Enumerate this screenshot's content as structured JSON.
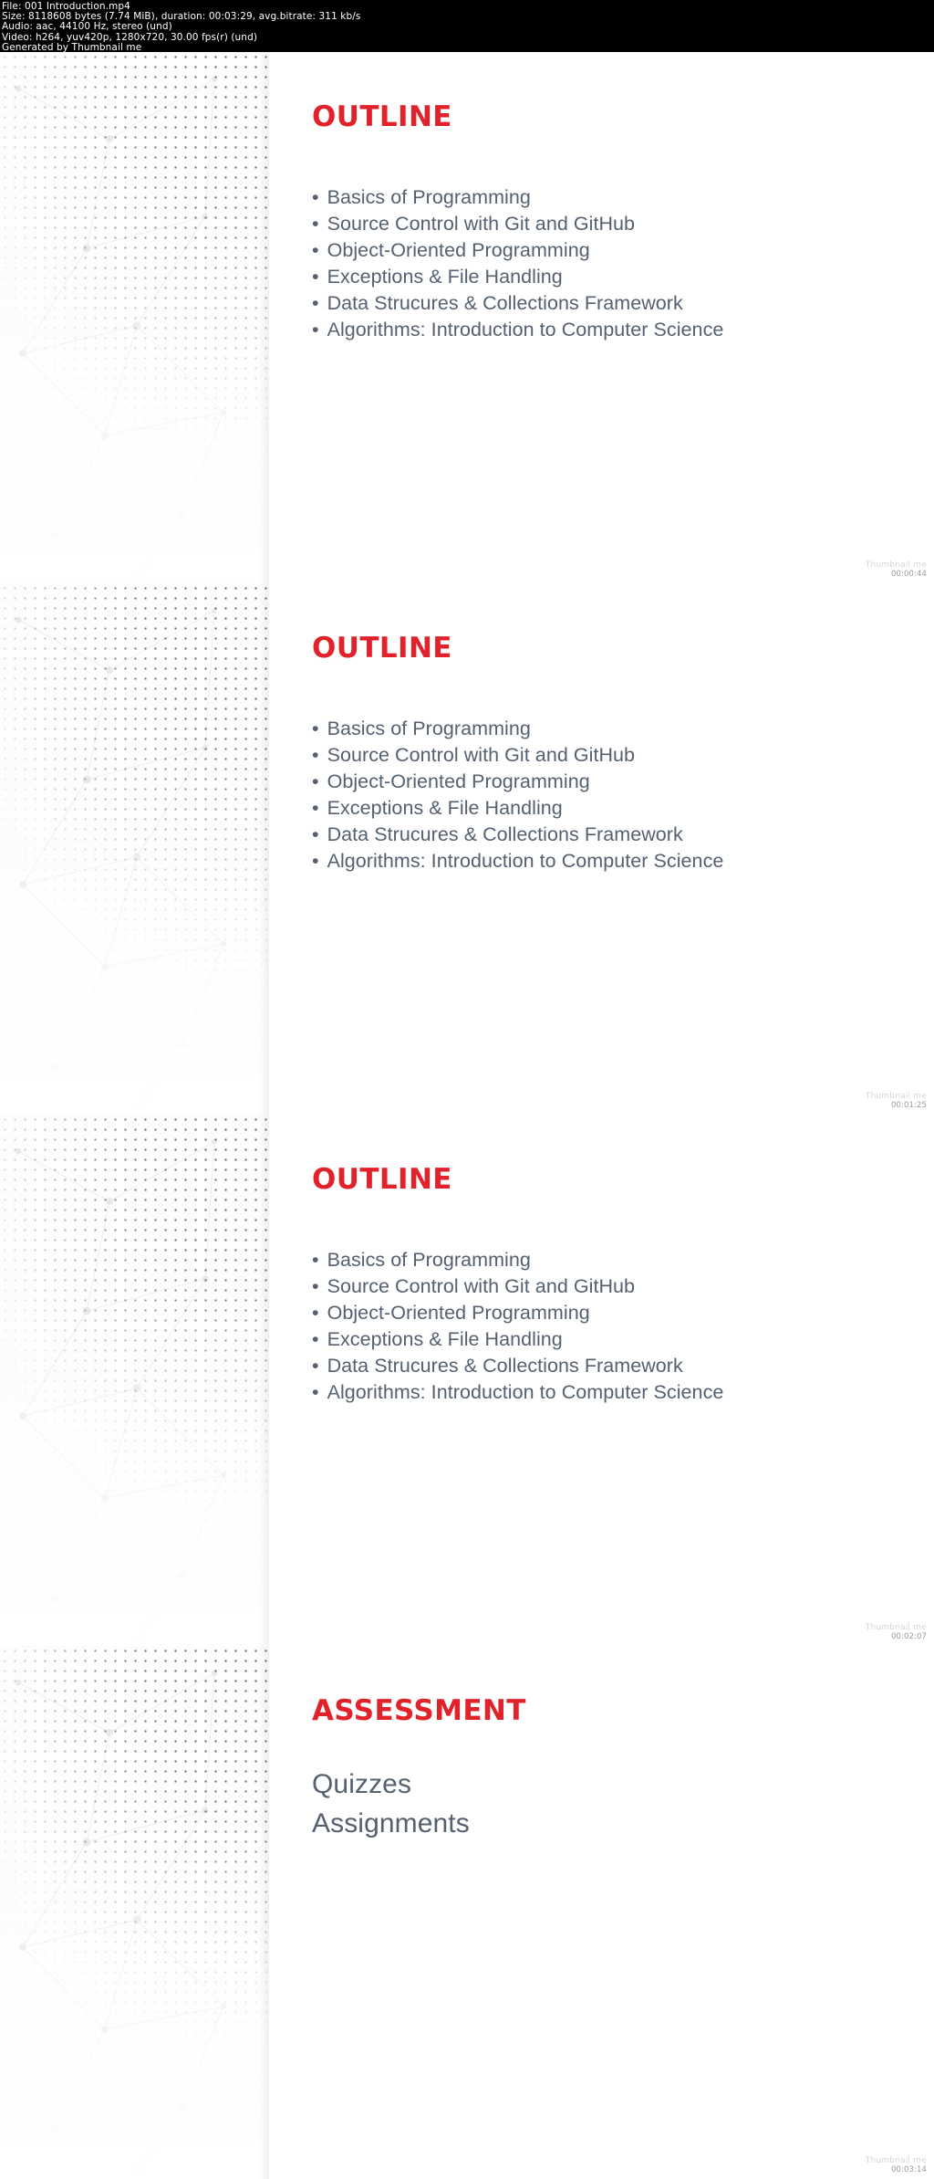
{
  "metadata": {
    "lines": [
      "File: 001 Introduction.mp4",
      "Size: 8118608 bytes (7.74 MiB), duration: 00:03:29, avg.bitrate: 311 kb/s",
      "Audio: aac, 44100 Hz, stereo (und)",
      "Video: h264, yuv420p, 1280x720, 30.00 fps(r) (und)",
      "Generated by Thumbnail me"
    ]
  },
  "colors": {
    "title_red": "#e1222b",
    "body_slate": "#556070",
    "band_black": "#000000",
    "slide_white": "#ffffff"
  },
  "frames": [
    {
      "title": "OUTLINE",
      "bullet_marker": "•",
      "bullets": [
        "Basics of Programming",
        "Source Control with Git and GitHub",
        "Object-Oriented Programming",
        "Exceptions & File Handling",
        "Data Strucures & Collections Framework",
        "Algorithms: Introduction to Computer Science"
      ],
      "plain_lines": [],
      "stamp_label": "Thumbnail me",
      "timestamp": "00:00:44"
    },
    {
      "title": "OUTLINE",
      "bullet_marker": "•",
      "bullets": [
        "Basics of Programming",
        "Source Control with Git and GitHub",
        "Object-Oriented Programming",
        "Exceptions & File Handling",
        "Data Strucures & Collections Framework",
        "Algorithms: Introduction to Computer Science"
      ],
      "plain_lines": [],
      "stamp_label": "Thumbnail me",
      "timestamp": "00:01:25"
    },
    {
      "title": "OUTLINE",
      "bullet_marker": "•",
      "bullets": [
        "Basics of Programming",
        "Source Control with Git and GitHub",
        "Object-Oriented Programming",
        "Exceptions & File Handling",
        "Data Strucures & Collections Framework",
        "Algorithms: Introduction to Computer Science"
      ],
      "plain_lines": [],
      "stamp_label": "Thumbnail me",
      "timestamp": "00:02:07"
    },
    {
      "title": "ASSESSMENT",
      "bullet_marker": "•",
      "bullets": [],
      "plain_lines": [
        "Quizzes",
        "Assignments"
      ],
      "stamp_label": "Thumbnail me",
      "timestamp": "00:03:14"
    }
  ]
}
